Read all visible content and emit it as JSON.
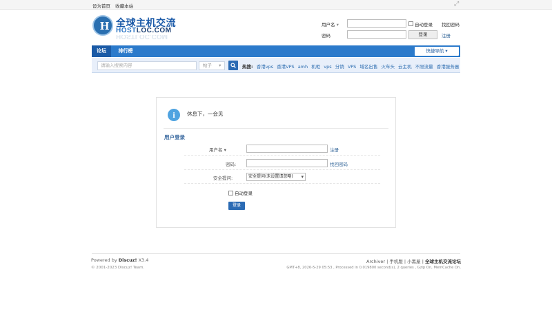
{
  "topbar": {
    "set_home": "设为首页",
    "bookmark": "收藏本站"
  },
  "logo": {
    "title_cn": "全球主机交流",
    "title_en_a": "HOST",
    "title_en_b": "LOC.COM"
  },
  "login_top": {
    "username_label": "用户名",
    "password_label": "密码",
    "auto_login": "自动登录",
    "forgot": "找回密码",
    "submit": "登录",
    "register": "注册"
  },
  "nav": {
    "tabs": [
      "论坛",
      "排行榜"
    ],
    "quick_nav": "快捷导航"
  },
  "search": {
    "placeholder": "请输入搜索内容",
    "type": "帖子",
    "hot_label": "热搜:",
    "hot": [
      "香港vps",
      "香港VPS",
      "amh",
      "机柜",
      "vps",
      "分销",
      "VPS",
      "域名出售",
      "火车头",
      "云主机",
      "不限流量",
      "香港服务器"
    ]
  },
  "login_panel": {
    "message": "休息下，一会见",
    "title": "用户登录",
    "username_label": "用户名",
    "register_link": "注册",
    "password_label": "密码:",
    "forgot_link": "找回密码",
    "security_label": "安全提问:",
    "security_value": "安全提问(未设置请忽略)",
    "auto_login": "自动登录",
    "submit": "登录"
  },
  "footer": {
    "powered_prefix": "Powered by",
    "brand": "Discuz!",
    "version": "X3.4",
    "copyright": "© 2001-2023 Discuz! Team.",
    "links": [
      "Archiver",
      "手机版",
      "小黑屋",
      "全球主机交流论坛"
    ],
    "tech": "GMT+8, 2026-5-29 05:53 , Processed in 0.019800 second(s), 2 queries , Gzip On, MemCache On."
  }
}
